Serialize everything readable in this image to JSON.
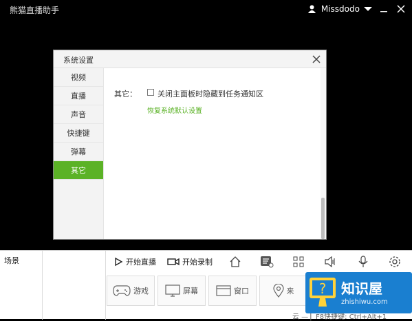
{
  "window": {
    "app_title": "熊猫直播助手",
    "username": "Missdodo"
  },
  "dialog": {
    "title": "系统设置",
    "nav": [
      "视频",
      "直播",
      "声音",
      "快捷键",
      "弹幕",
      "其它"
    ],
    "active_index": 5,
    "option_label": "其它：",
    "checkbox_label": "关闭主面板时隐藏到任务通知区",
    "checkbox_checked": false,
    "restore_link": "恢复系统默认设置"
  },
  "bottom": {
    "scene_label": "场景",
    "start_live": "开始直播",
    "start_record": "开始录制",
    "sources": [
      "游戏",
      "屏幕",
      "窗口",
      "来"
    ],
    "footer_text": "云 — ▏F8快捷键: Ctrl+Alt+1"
  },
  "watermark": {
    "brand": "知识屋",
    "domain": "zhishiwu.com",
    "color": "#1a7fd0"
  }
}
